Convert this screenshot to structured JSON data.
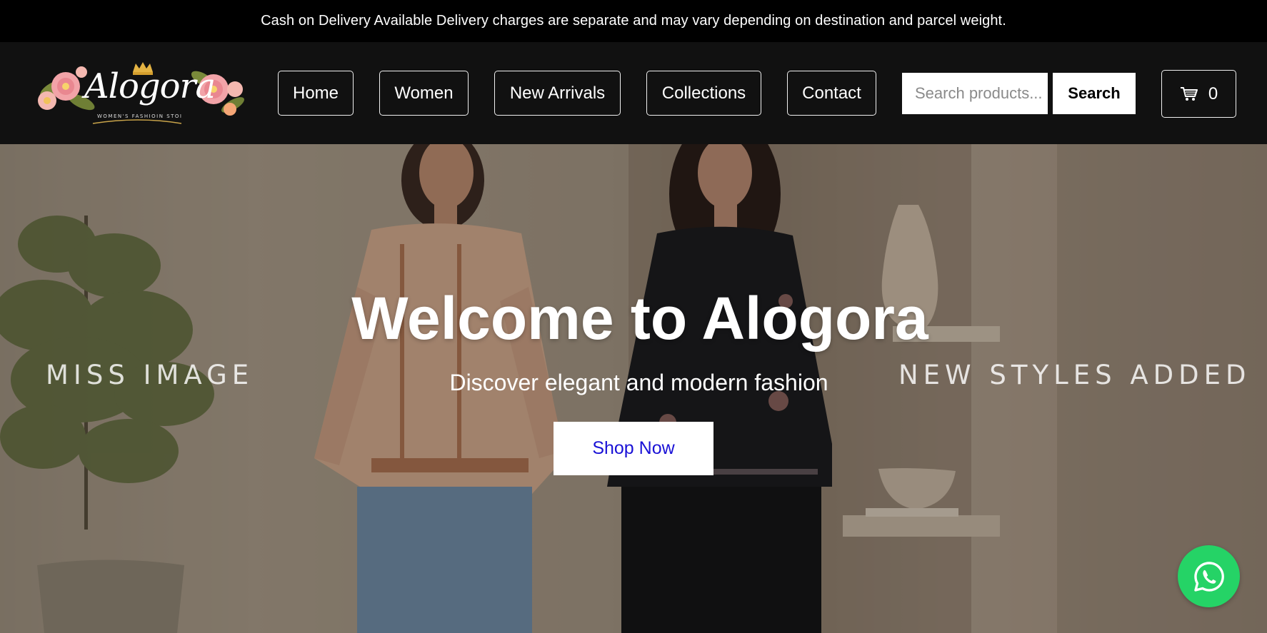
{
  "announcement": "Cash on Delivery Available Delivery charges are separate and may vary depending on destination and parcel weight.",
  "brand": {
    "name": "Alogora",
    "tagline": "WOMEN'S FASHIOIN STOI"
  },
  "nav": {
    "items": [
      {
        "label": "Home"
      },
      {
        "label": "Women"
      },
      {
        "label": "New Arrivals"
      },
      {
        "label": "Collections"
      },
      {
        "label": "Contact"
      }
    ]
  },
  "search": {
    "placeholder": "Search products...",
    "button_label": "Search"
  },
  "cart": {
    "count": "0",
    "icon": "cart-icon"
  },
  "hero": {
    "title": "Welcome to Alogora",
    "subtitle": "Discover elegant and modern fashion",
    "cta_label": "Shop Now",
    "left_caption": "MISS IMAGE",
    "right_caption": "NEW STYLES ADDED"
  },
  "floating": {
    "whatsapp_icon": "whatsapp-icon"
  },
  "colors": {
    "header_bg": "#111111",
    "announce_bg": "#000000",
    "cta_text": "#1a12d6",
    "whatsapp": "#25d366"
  }
}
